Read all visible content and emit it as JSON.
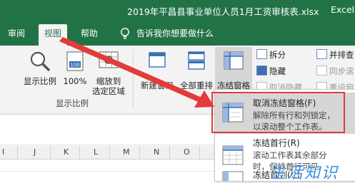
{
  "window": {
    "title": "2019年平昌县事业单位人员1月工资审核表.xlsx",
    "app_name": "Excel"
  },
  "tabs": [
    {
      "label": "审阅",
      "active": false
    },
    {
      "label": "视图",
      "active": true
    },
    {
      "label": "帮助",
      "active": false
    }
  ],
  "tell_me": {
    "text": "告诉我你想要做什么",
    "icon": "lightbulb-icon"
  },
  "ribbon": {
    "zoom_group": {
      "label": "显示比例",
      "buttons": [
        {
          "label": "显示比例",
          "icon": "magnifier-icon"
        },
        {
          "label": "100%",
          "icon": "100-percent-icon"
        },
        {
          "label_line1": "缩放到",
          "label_line2": "选定区域",
          "icon": "zoom-selection-icon"
        }
      ]
    },
    "window_group": {
      "new_window": "新建窗口",
      "arrange_all": "全部重排",
      "freeze_panes": "冻结窗格",
      "split": "拆分",
      "hide": "隐藏",
      "unhide": "取消隐藏",
      "side_by_side": "并排查",
      "sync_scroll": "同步滚",
      "reset_position": "重设窗"
    }
  },
  "columns": [
    "I",
    "J",
    "K",
    "L",
    "M",
    "N",
    "O"
  ],
  "freeze_menu": {
    "items": [
      {
        "title": "取消冻结窗格(F)",
        "desc_line1": "解除所有行和列锁定，",
        "desc_line2": "以滚动整个工作表。",
        "icon": "unfreeze-panes-icon",
        "highlighted": true
      },
      {
        "title": "冻结首行(R)",
        "desc_line1": "滚动工作表其余部分",
        "desc_line2": "时，保持首行可见。",
        "icon": "freeze-top-row-icon",
        "highlighted": false
      },
      {
        "title": "冻结首列(C)",
        "icon": "freeze-first-column-icon",
        "highlighted": false
      }
    ]
  },
  "annotation": {
    "color": "#e23b3b"
  },
  "watermark": {
    "text": "生活知识"
  },
  "colors": {
    "excel_green": "#217346",
    "ribbon_bg": "#f3f3f3",
    "highlight": "#d6d6d6"
  }
}
